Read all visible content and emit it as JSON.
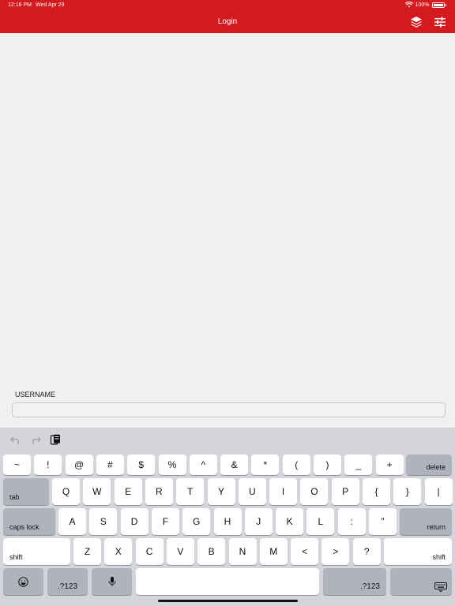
{
  "status_bar": {
    "time": "12:16 PM",
    "date": "Wed Apr 29",
    "battery": "100%",
    "battery_level": 1.0
  },
  "header": {
    "title": "Login",
    "icons": [
      "layers-icon",
      "settings-sliders-icon"
    ]
  },
  "form": {
    "username_label": "USERNAME",
    "username_value": "",
    "username_placeholder": ""
  },
  "keyboard": {
    "toolbar_icons": [
      "undo-icon",
      "redo-icon",
      "paste-icon"
    ],
    "number_row": [
      "~",
      "!",
      "@",
      "#",
      "$",
      "%",
      "^",
      "&",
      "*",
      "(",
      ")",
      "_",
      "+"
    ],
    "delete_label": "delete",
    "tab_label": "tab",
    "row_q": [
      "Q",
      "W",
      "E",
      "R",
      "T",
      "Y",
      "U",
      "I",
      "O",
      "P",
      "{",
      "}",
      "|"
    ],
    "caps_label": "caps lock",
    "row_a": [
      "A",
      "S",
      "D",
      "F",
      "G",
      "H",
      "J",
      "K",
      "L",
      ":",
      "”"
    ],
    "return_label": "return",
    "shift_left_label": "shift",
    "row_z": [
      "Z",
      "X",
      "C",
      "V",
      "B",
      "N",
      "M",
      "<",
      ">",
      "?"
    ],
    "shift_right_label": "shift",
    "numbers_label_left": ".?123",
    "numbers_label_right": ".?123",
    "bottom_icons": [
      "emoji-icon",
      "microphone-icon",
      "keyboard-dismiss-icon"
    ]
  },
  "colors": {
    "header_bg": "#d4191f",
    "keyboard_bg": "#d3d5db",
    "key_light": "#ffffff",
    "key_dark": "#aeb3bd"
  }
}
